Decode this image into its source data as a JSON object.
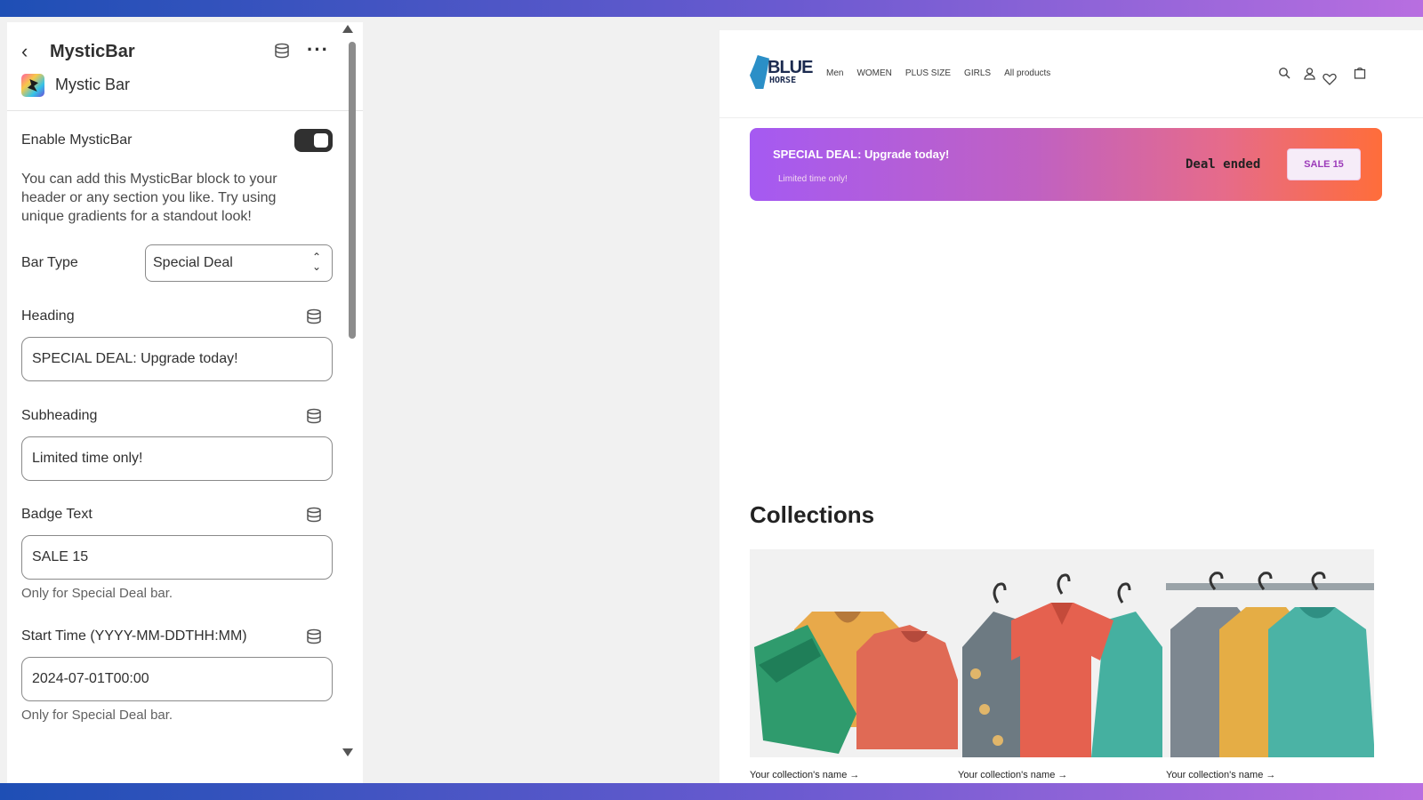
{
  "editor": {
    "title": "MysticBar",
    "app_name": "Mystic Bar",
    "enable_label": "Enable MysticBar",
    "enabled": true,
    "helptext": "You can add this MysticBar block to your header or any section you like. Try using unique gradients for a standout look!",
    "bar_type_label": "Bar Type",
    "bar_type_value": "Special Deal",
    "heading_label": "Heading",
    "heading_value": "SPECIAL DEAL: Upgrade today!",
    "subheading_label": "Subheading",
    "subheading_value": "Limited time only!",
    "badge_label": "Badge Text",
    "badge_value": "SALE 15",
    "badge_note": "Only for Special Deal bar.",
    "start_label": "Start Time (YYYY-MM-DDTHH:MM)",
    "start_value": "2024-07-01T00:00",
    "start_note": "Only for Special Deal bar."
  },
  "store": {
    "logo_top": "BLUE",
    "logo_bottom": "HORSE",
    "nav": [
      "Men",
      "WOMEN",
      "PLUS SIZE",
      "GIRLS",
      "All products"
    ],
    "bar": {
      "heading": "SPECIAL DEAL: Upgrade today!",
      "subheading": "Limited time only!",
      "status": "Deal ended",
      "badge": "SALE 15"
    },
    "collections_title": "Collections",
    "collection_labels": [
      "Your collection's name →",
      "Your collection's name →",
      "Your collection's name →"
    ]
  },
  "colors": {
    "gradient_start": "#a55af2",
    "gradient_end": "#ff6d3a",
    "toggle_on": "#303030"
  }
}
